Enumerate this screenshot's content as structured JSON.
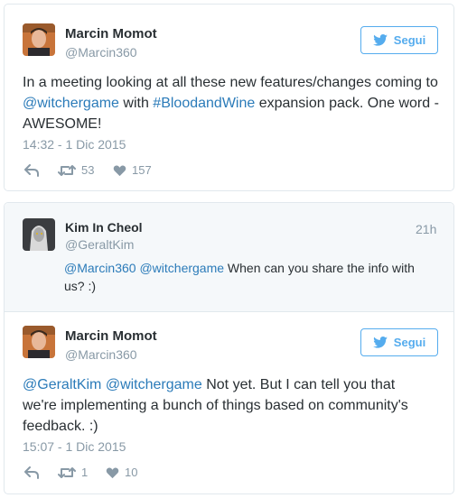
{
  "tweet1": {
    "name": "Marcin Momot",
    "handle": "@Marcin360",
    "follow_label": "Segui",
    "text_before": "In a meeting looking at all these new features/changes coming to ",
    "mention": "@witchergame",
    "text_mid": " with ",
    "hashtag": "#BloodandWine",
    "text_after": " expansion pack. One word - AWESOME!",
    "timestamp": "14:32 - 1 Dic 2015",
    "retweets": "53",
    "likes": "157"
  },
  "reply": {
    "name": "Kim In Cheol",
    "handle": "@GeraltKim",
    "time_ago": "21h",
    "mention1": "@Marcin360",
    "mention2": "@witchergame",
    "text": " When can you share the info with us? :)"
  },
  "tweet2": {
    "name": "Marcin Momot",
    "handle": "@Marcin360",
    "follow_label": "Segui",
    "mention1": "@GeraltKim",
    "mention2": "@witchergame",
    "text": " Not yet. But I can tell you that we're implementing a bunch of things based on community's feedback. :)",
    "timestamp": "15:07 - 1 Dic 2015",
    "retweets": "1",
    "likes": "10"
  },
  "icons": {
    "follow": "twitter-bird-icon",
    "reply": "reply-arrow-icon",
    "retweet": "retweet-icon",
    "like": "heart-icon"
  },
  "colors": {
    "link": "#2b7bb9",
    "brand": "#55acee",
    "muted": "#8899a6",
    "text": "#292f33",
    "reply_bg": "#f5f8fa"
  }
}
